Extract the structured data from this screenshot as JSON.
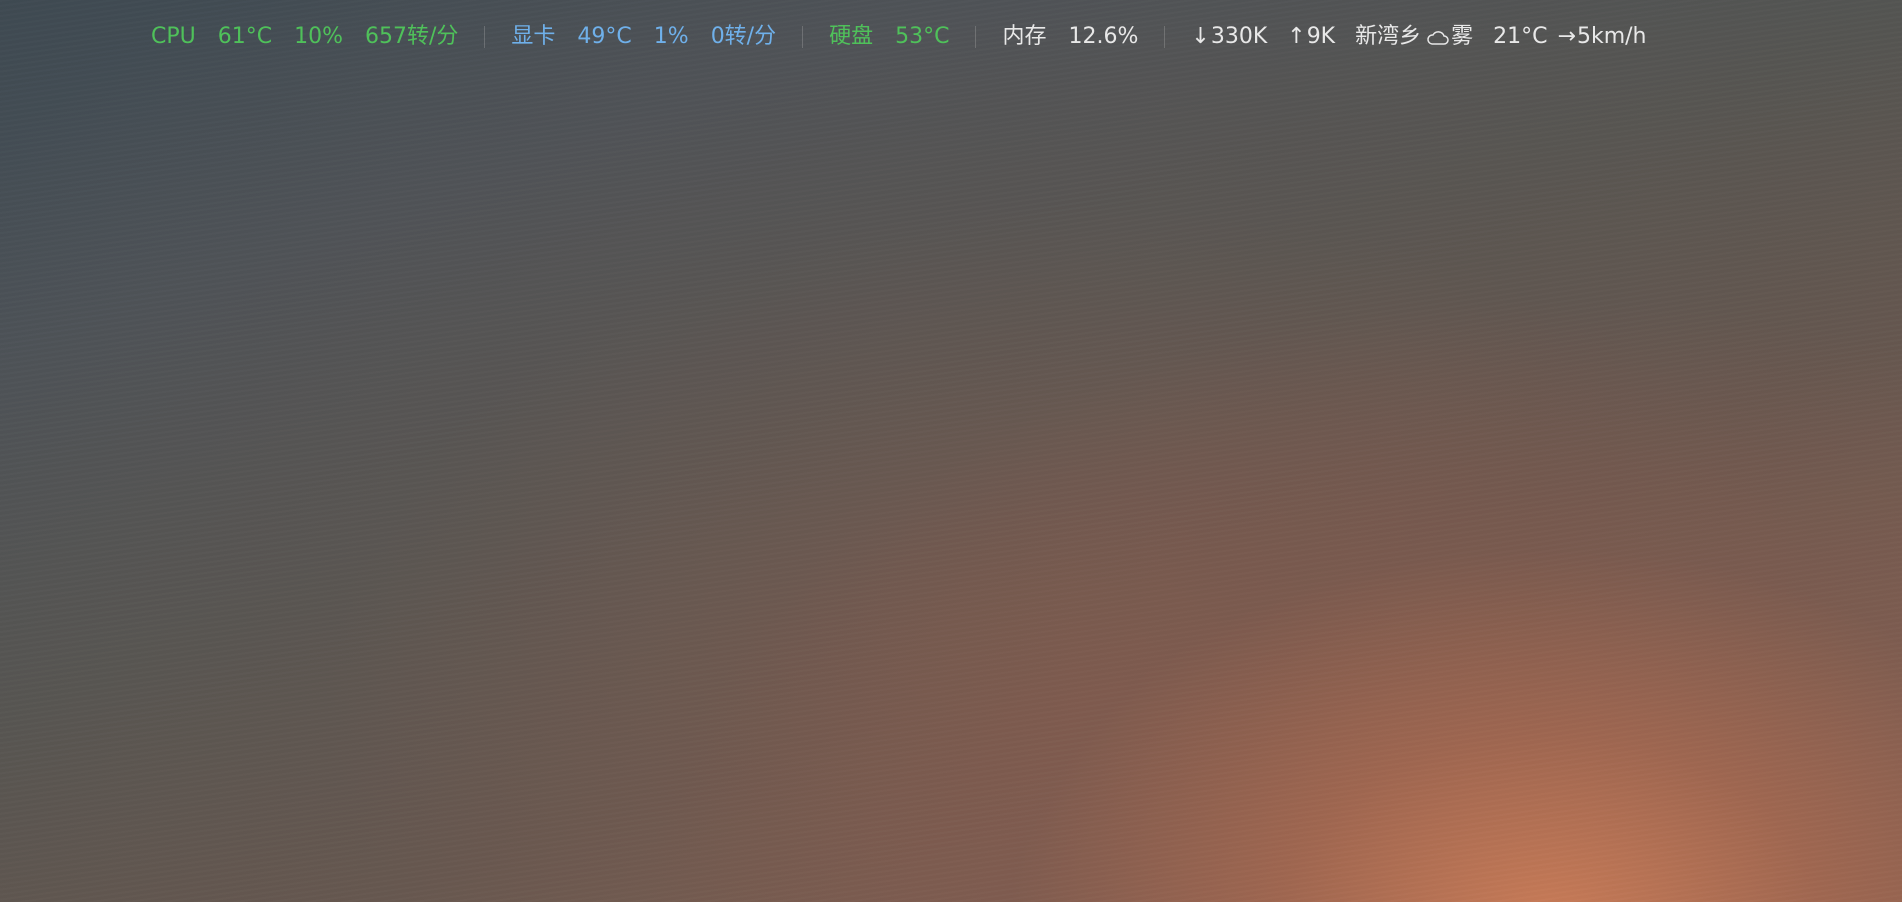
{
  "colors": {
    "cpu": "#4fc15a",
    "gpu": "#6fb0ea",
    "disk": "#4fc15a",
    "neutral": "#e8e8e8"
  },
  "status_bar": {
    "cpu": {
      "label": "CPU",
      "temp": "61°C",
      "usage": "10%",
      "fan": "657转/分"
    },
    "gpu": {
      "label": "显卡",
      "temp": "49°C",
      "usage": "1%",
      "fan": "0转/分"
    },
    "disk": {
      "label": "硬盘",
      "temp": "53°C"
    },
    "memory": {
      "label": "内存",
      "usage": "12.6%"
    },
    "network": {
      "down_icon": "arrow-down-icon",
      "down_arrow": "↓",
      "down": "330K",
      "up_icon": "arrow-up-icon",
      "up_arrow": "↑",
      "up": "9K"
    },
    "weather": {
      "location": "新湾乡",
      "icon": "cloud-icon",
      "condition": "雾",
      "temp": "21°C",
      "wind_icon": "arrow-right-icon",
      "wind_arrow": "→",
      "wind": "5km/h"
    }
  }
}
